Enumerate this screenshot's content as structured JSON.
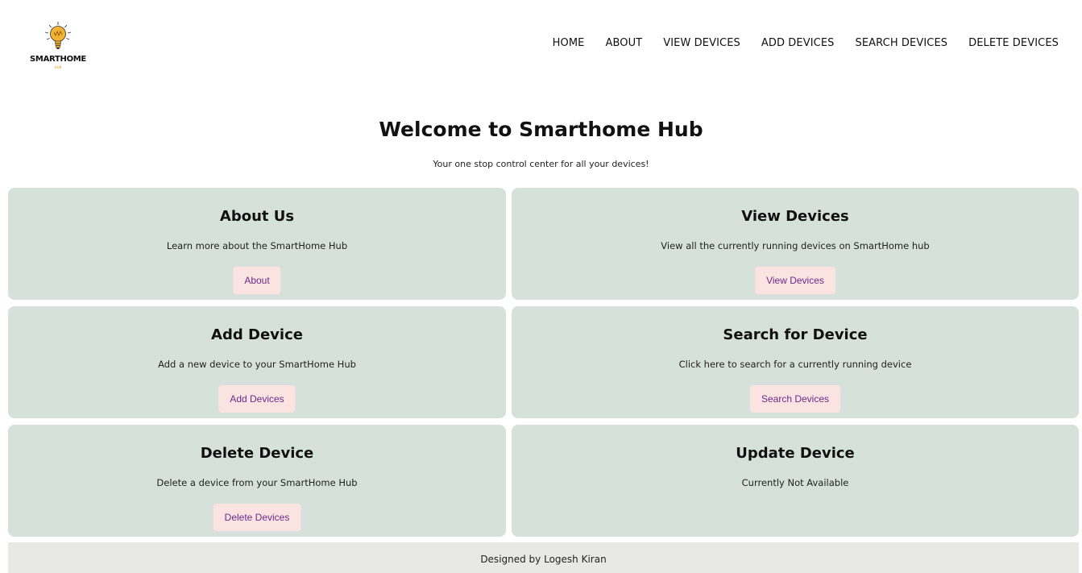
{
  "logo": {
    "brand": "SMARTHOME",
    "sub": "HUB"
  },
  "nav": {
    "home": "HOME",
    "about": "ABOUT",
    "view": "VIEW DEVICES",
    "add": "ADD DEVICES",
    "search": "SEARCH DEVICES",
    "delete": "DELETE DEVICES"
  },
  "hero": {
    "title": "Welcome to Smarthome Hub",
    "subtitle": "Your one stop control center for all your devices!"
  },
  "cards": {
    "about": {
      "title": "About Us",
      "desc": "Learn more about the SmartHome Hub",
      "button": "About"
    },
    "view": {
      "title": "View Devices",
      "desc": "View all the currently running devices on SmartHome hub",
      "button": "View Devices"
    },
    "add": {
      "title": "Add Device",
      "desc": "Add a new device to your SmartHome Hub",
      "button": "Add Devices"
    },
    "search": {
      "title": "Search for Device",
      "desc": "Click here to search for a currently running device",
      "button": "Search Devices"
    },
    "delete": {
      "title": "Delete Device",
      "desc": "Delete a device from your SmartHome Hub",
      "button": "Delete Devices"
    },
    "update": {
      "title": "Update Device",
      "desc": "Currently Not Available"
    }
  },
  "footer": {
    "text": "Designed by Logesh Kiran"
  },
  "colors": {
    "card_bg": "#d6e1dc",
    "button_bg": "#fbe3e1",
    "button_text": "#6a2a8a",
    "footer_bg": "#e8e9e4",
    "logo_bulb": "#f2b233"
  }
}
